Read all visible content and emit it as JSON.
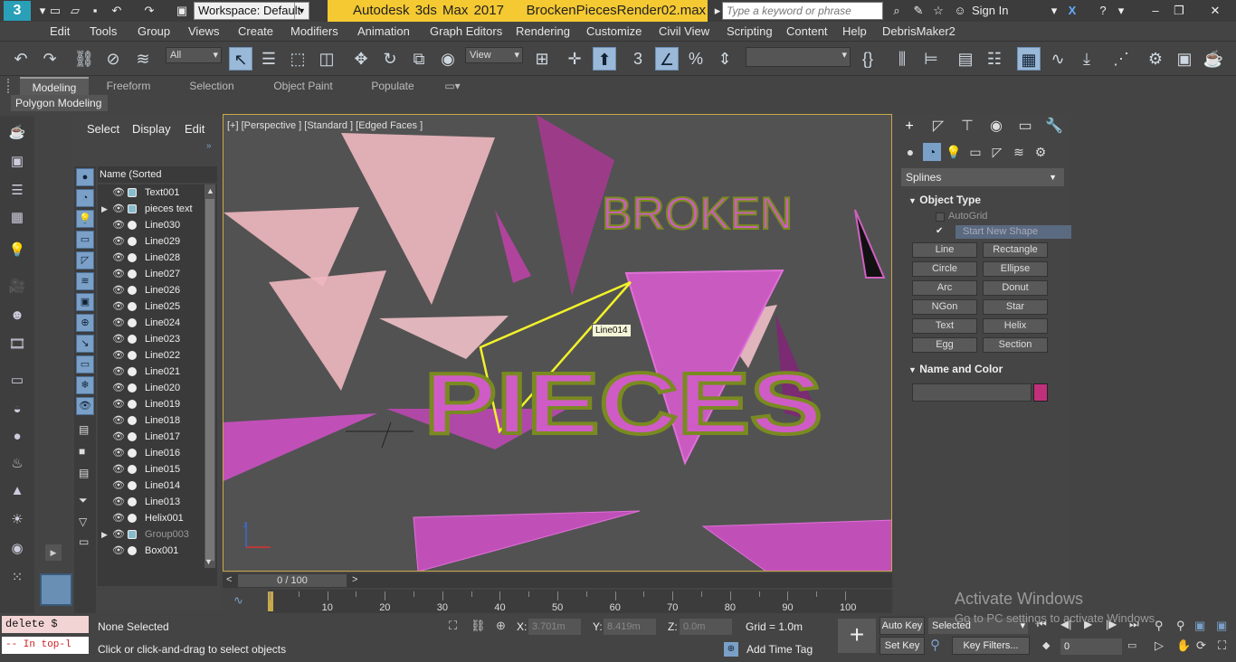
{
  "titlebar": {
    "app_title": "Autodesk 3ds Max 2017",
    "file_name": "BrockenPiecesRender02.max",
    "workspace": "Workspace: Default",
    "search_placeholder": "Type a keyword or phrase",
    "sign_in": "Sign In"
  },
  "menus": [
    "Edit",
    "Tools",
    "Group",
    "Views",
    "Create",
    "Modifiers",
    "Animation",
    "Graph Editors",
    "Rendering",
    "Customize",
    "Civil View",
    "Scripting",
    "Content",
    "Help",
    "DebrisMaker2"
  ],
  "toolbar": {
    "selection_filter": "All",
    "ref_coord": "View",
    "named_selection": ""
  },
  "ribbon": {
    "tabs": [
      "Modeling",
      "Freeform",
      "Selection",
      "Object Paint",
      "Populate"
    ],
    "active_tab": "Modeling",
    "sub_panel": "Polygon Modeling"
  },
  "scene_explorer": {
    "menu": [
      "Select",
      "Display",
      "Edit"
    ],
    "column_header": "Name (Sorted Descending)",
    "items": [
      {
        "name": "Text001",
        "type": "group"
      },
      {
        "name": "pieces text",
        "type": "group"
      },
      {
        "name": "Line030",
        "type": "shape"
      },
      {
        "name": "Line029",
        "type": "shape"
      },
      {
        "name": "Line028",
        "type": "shape"
      },
      {
        "name": "Line027",
        "type": "shape"
      },
      {
        "name": "Line026",
        "type": "shape"
      },
      {
        "name": "Line025",
        "type": "shape"
      },
      {
        "name": "Line024",
        "type": "shape"
      },
      {
        "name": "Line023",
        "type": "shape"
      },
      {
        "name": "Line022",
        "type": "shape"
      },
      {
        "name": "Line021",
        "type": "shape"
      },
      {
        "name": "Line020",
        "type": "shape"
      },
      {
        "name": "Line019",
        "type": "shape"
      },
      {
        "name": "Line018",
        "type": "shape"
      },
      {
        "name": "Line017",
        "type": "shape"
      },
      {
        "name": "Line016",
        "type": "shape"
      },
      {
        "name": "Line015",
        "type": "shape"
      },
      {
        "name": "Line014",
        "type": "shape"
      },
      {
        "name": "Line013",
        "type": "shape"
      },
      {
        "name": "Helix001",
        "type": "shape"
      },
      {
        "name": "Group003",
        "type": "group"
      },
      {
        "name": "Box001",
        "type": "shape"
      }
    ]
  },
  "viewport": {
    "label": "[+] [Perspective ] [Standard ] [Edged Faces ]",
    "tooltip": "Line014",
    "text_broken": "BROKEN",
    "text_pieces": "PIECES"
  },
  "timeline": {
    "slider": "0 / 100",
    "ticks": [
      "10",
      "20",
      "30",
      "40",
      "50",
      "60",
      "70",
      "80",
      "90",
      "100"
    ]
  },
  "command_panel": {
    "category": "Splines",
    "object_type_title": "Object Type",
    "autogrid": "AutoGrid",
    "start_new_shape": "Start New Shape",
    "buttons": [
      "Line",
      "Rectangle",
      "Circle",
      "Ellipse",
      "Arc",
      "Donut",
      "NGon",
      "Star",
      "Text",
      "Helix",
      "Egg",
      "Section"
    ],
    "name_color_title": "Name and Color",
    "color": "#c0307a"
  },
  "status": {
    "maxscript_input": "delete $",
    "maxscript_output": "-- In top-l",
    "selection": "None Selected",
    "prompt": "Click or click-and-drag to select objects",
    "x_label": "X:",
    "x_value": "3.701m",
    "y_label": "Y:",
    "y_value": "8.419m",
    "z_label": "Z:",
    "z_value": "0.0m",
    "grid": "Grid = 1.0m",
    "add_time_tag": "Add Time Tag",
    "auto_key": "Auto Key",
    "set_key": "Set Key",
    "selected": "Selected",
    "key_filters": "Key Filters...",
    "frame": "0",
    "activate_title": "Activate Windows",
    "activate_sub": "Go to PC settings to activate Windows."
  }
}
